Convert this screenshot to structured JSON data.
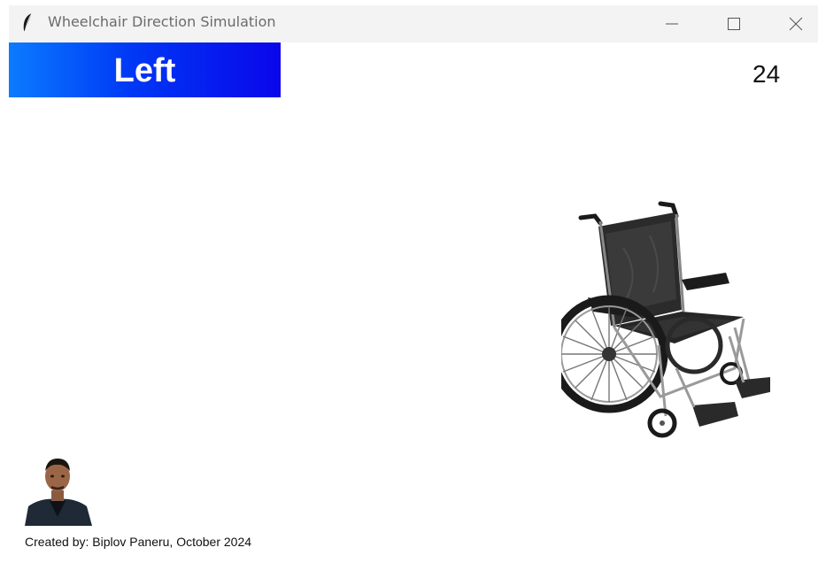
{
  "window": {
    "title": "Wheelchair Direction Simulation",
    "icon": "feather-icon",
    "controls": [
      "minimize-icon",
      "maximize-icon",
      "close-icon"
    ]
  },
  "direction": {
    "label": "Left",
    "gradient_colors": [
      "#0b7bff",
      "#0a06ea"
    ]
  },
  "counter": {
    "value": "24"
  },
  "images": {
    "wheelchair": "wheelchair-image",
    "creator": "creator-photo"
  },
  "footer": {
    "credit": "Created by: Biplov Paneru, October 2024"
  }
}
